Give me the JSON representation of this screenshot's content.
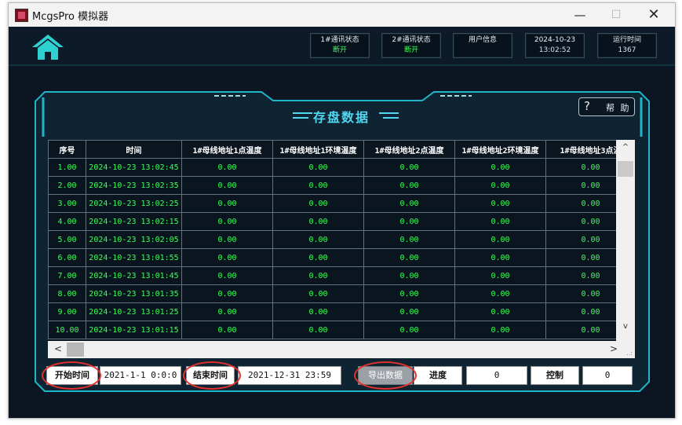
{
  "window": {
    "title": "McgsPro 模拟器",
    "min": "—",
    "max": "☐",
    "close": "✕"
  },
  "header": {
    "status1": {
      "label": "1#通讯状态",
      "value": "断开"
    },
    "status2": {
      "label": "2#通讯状态",
      "value": "断开"
    },
    "user": {
      "label": "用户信息"
    },
    "datetime": {
      "date": "2024-10-23",
      "time": "13:02:52"
    },
    "runtime": {
      "label": "运行时间",
      "value": "1367"
    }
  },
  "panel": {
    "title": "存盘数据",
    "help_icon": "?",
    "help_label": "帮 助"
  },
  "table": {
    "columns": [
      "序号",
      "时间",
      "1#母线地址1点温度",
      "1#母线地址1环境温度",
      "1#母线地址2点温度",
      "1#母线地址2环境温度",
      "1#母线地址3点温"
    ],
    "rows": [
      [
        "1.00",
        "2024-10-23 13:02:45",
        "0.00",
        "0.00",
        "0.00",
        "0.00",
        "0.00"
      ],
      [
        "2.00",
        "2024-10-23 13:02:35",
        "0.00",
        "0.00",
        "0.00",
        "0.00",
        "0.00"
      ],
      [
        "3.00",
        "2024-10-23 13:02:25",
        "0.00",
        "0.00",
        "0.00",
        "0.00",
        "0.00"
      ],
      [
        "4.00",
        "2024-10-23 13:02:15",
        "0.00",
        "0.00",
        "0.00",
        "0.00",
        "0.00"
      ],
      [
        "5.00",
        "2024-10-23 13:02:05",
        "0.00",
        "0.00",
        "0.00",
        "0.00",
        "0.00"
      ],
      [
        "6.00",
        "2024-10-23 13:01:55",
        "0.00",
        "0.00",
        "0.00",
        "0.00",
        "0.00"
      ],
      [
        "7.00",
        "2024-10-23 13:01:45",
        "0.00",
        "0.00",
        "0.00",
        "0.00",
        "0.00"
      ],
      [
        "8.00",
        "2024-10-23 13:01:35",
        "0.00",
        "0.00",
        "0.00",
        "0.00",
        "0.00"
      ],
      [
        "9.00",
        "2024-10-23 13:01:25",
        "0.00",
        "0.00",
        "0.00",
        "0.00",
        "0.00"
      ],
      [
        "10.00",
        "2024-10-23 13:01:15",
        "0.00",
        "0.00",
        "0.00",
        "0.00",
        "0.00"
      ]
    ]
  },
  "scroll": {
    "up": "^",
    "down": "v",
    "left": "<",
    "right": ">",
    "grip": "..:"
  },
  "footer": {
    "start_label": "开始时间",
    "start_value": "2021-1-1  0:0:0",
    "end_label": "结束时间",
    "end_value": "2021-12-31  23:59",
    "export_label": "导出数据",
    "progress_label": "进度",
    "progress_value": "0",
    "control_label": "控制",
    "control_value": "0"
  },
  "colors": {
    "value_green": "#3cff5a",
    "accent_cyan": "#4fd8f2",
    "annotation_red": "#e3312b"
  }
}
